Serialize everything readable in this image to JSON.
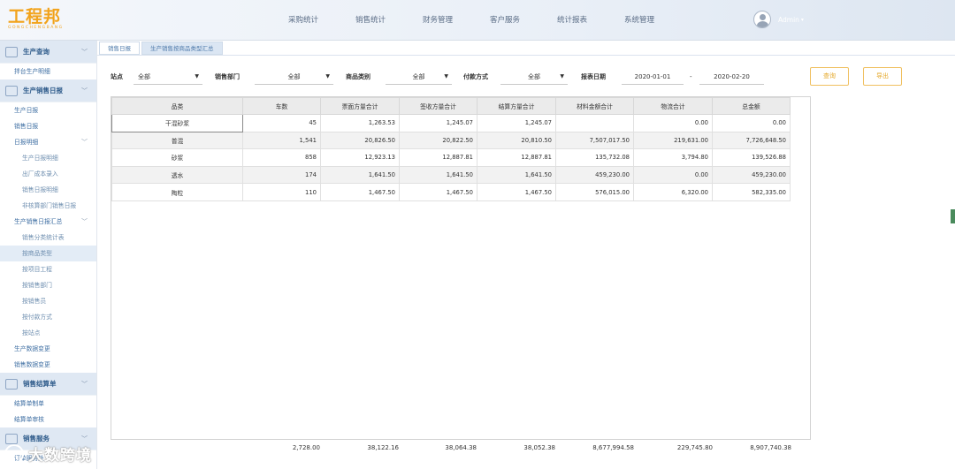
{
  "logo": {
    "main": "工程邦",
    "sub": "GONGCHENGBANG"
  },
  "nav": [
    "采购统计",
    "销售统计",
    "财务管理",
    "客户服务",
    "统计报表",
    "系统管理"
  ],
  "user": {
    "name": "Admin",
    "caret": "▾"
  },
  "sidebar": {
    "g1": {
      "label": "生产查询",
      "items": [
        "拌台生产明细"
      ]
    },
    "g2": {
      "label": "生产销售日报",
      "items": [
        "生产日报",
        "销售日报",
        "日报明细",
        "生产日报明细",
        "出厂成本录入",
        "销售日报明细",
        "非核算部门销售日报",
        "生产销售日报汇总",
        "销售分类统计表",
        "按商品类型",
        "按项目工程",
        "按销售部门",
        "按销售员",
        "按付款方式",
        "按站点",
        "生产数据变更",
        "销售数据变更"
      ]
    },
    "g3": {
      "label": "销售结算单",
      "items": [
        "结算单制单",
        "结算单审核"
      ]
    },
    "g4": {
      "label": "销售服务",
      "items": [
        "订单服务处"
      ]
    }
  },
  "tabs": [
    "销售日报",
    "生产销售按商品类型汇总"
  ],
  "filters": {
    "station": {
      "label": "站点",
      "value": "全部"
    },
    "dept": {
      "label": "销售部门",
      "value": "全部"
    },
    "category": {
      "label": "商品类别",
      "value": "全部"
    },
    "payment": {
      "label": "付款方式",
      "value": "全部"
    },
    "date": {
      "label": "报表日期",
      "from": "2020-01-01",
      "sep": "-",
      "to": "2020-02-20"
    },
    "arrow": "▼"
  },
  "buttons": {
    "query": "查询",
    "export": "导出"
  },
  "table": {
    "headers": [
      "品类",
      "车数",
      "票面方量合计",
      "签收方量合计",
      "结算方量合计",
      "材料金额合计",
      "物流合计",
      "总金额"
    ],
    "rows": [
      [
        "干混砂浆",
        "45",
        "1,263.53",
        "1,245.07",
        "1,245.07",
        "",
        "0.00",
        "0.00"
      ],
      [
        "普混",
        "1,541",
        "20,826.50",
        "20,822.50",
        "20,810.50",
        "7,507,017.50",
        "219,631.00",
        "7,726,648.50"
      ],
      [
        "砂浆",
        "858",
        "12,923.13",
        "12,887.81",
        "12,887.81",
        "135,732.08",
        "3,794.80",
        "139,526.88"
      ],
      [
        "透水",
        "174",
        "1,641.50",
        "1,641.50",
        "1,641.50",
        "459,230.00",
        "0.00",
        "459,230.00"
      ],
      [
        "陶粒",
        "110",
        "1,467.50",
        "1,467.50",
        "1,467.50",
        "576,015.00",
        "6,320.00",
        "582,335.00"
      ]
    ],
    "totals": [
      "2,728.00",
      "38,122.16",
      "38,064.38",
      "38,052.38",
      "8,677,994.58",
      "229,745.80",
      "8,907,740.38"
    ]
  },
  "watermark": "大数跨境"
}
